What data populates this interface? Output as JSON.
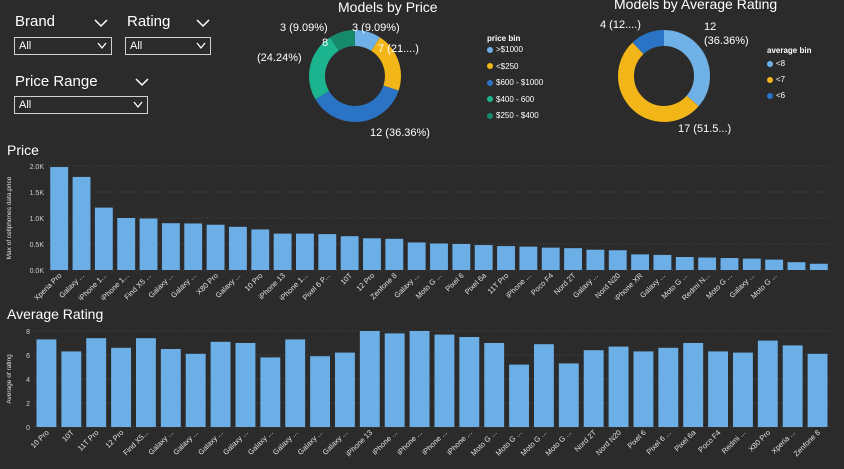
{
  "filters": {
    "brand": {
      "label": "Brand",
      "value": "All"
    },
    "rating": {
      "label": "Rating",
      "value": "All"
    },
    "price_range": {
      "label": "Price Range",
      "value": "All"
    }
  },
  "donut_price": {
    "title": "Models by Price",
    "legend_title": "price bin",
    "labels": {
      "a": "3 (9.09%)",
      "b": "7 (21....)",
      "c": "12 (36.36%)",
      "d": "8",
      "d2": "(24.24%)",
      "e": "3 (9.09%)"
    },
    "legend": [
      {
        "label": ">$1000",
        "color": "#6fb1e6"
      },
      {
        "label": "<$250",
        "color": "#f2b619"
      },
      {
        "label": "$600 - $1000",
        "color": "#2b73c4"
      },
      {
        "label": "$400 - 600",
        "color": "#1bb48e"
      },
      {
        "label": "$250 - $400",
        "color": "#178a6b"
      }
    ]
  },
  "donut_rating": {
    "title": "Models by Average Rating",
    "legend_title": "average bin",
    "labels": {
      "a": "4 (12....)",
      "b": "12",
      "b2": "(36.36%)",
      "c": "17 (51.5...)"
    },
    "legend": [
      {
        "label": "<8",
        "color": "#6fb1e6"
      },
      {
        "label": "<7",
        "color": "#f2b619"
      },
      {
        "label": "<6",
        "color": "#2b73c4"
      }
    ]
  },
  "chart_data": [
    {
      "type": "bar",
      "title": "Price",
      "ylabel": "Max of cellphones data.price",
      "ylim": [
        0,
        2000
      ],
      "yticks": [
        "0.0K",
        "0.5K",
        "1.0K",
        "1.5K",
        "2.0K"
      ],
      "categories": [
        "Xperia Pro",
        "Galaxy ...",
        "iPhone 1...",
        "iPhone 1...",
        "Find X5 ...",
        "Galaxy ...",
        "Galaxy ...",
        "X80 Pro",
        "Galaxy ...",
        "10 Pro",
        "iPhone 13",
        "iPhone 1...",
        "Pixel 6 P...",
        "10T",
        "12 Pro",
        "Zenfone 8",
        "Galaxy ...",
        "Moto G ...",
        "Pixel 6",
        "Pixel 6a",
        "11T Pro",
        "iPhone ...",
        "Poco F4",
        "Nord 2T",
        "Galaxy ...",
        "Nord N20",
        "iPhone XR",
        "Galaxy ...",
        "Moto G ...",
        "Redmi N...",
        "Moto G ...",
        "Galaxy ...",
        "Moto G ..."
      ],
      "values": [
        1980,
        1790,
        1200,
        1000,
        990,
        900,
        895,
        870,
        830,
        780,
        700,
        700,
        690,
        650,
        610,
        600,
        530,
        510,
        500,
        480,
        460,
        450,
        430,
        420,
        390,
        380,
        300,
        290,
        250,
        240,
        230,
        220,
        200,
        150,
        120
      ]
    },
    {
      "type": "bar",
      "title": "Average Rating",
      "ylabel": "Average of rating",
      "ylim": [
        0,
        8
      ],
      "yticks": [
        "0",
        "2",
        "4",
        "6",
        "8"
      ],
      "categories": [
        "10 Pro",
        "10T",
        "11T Pro",
        "12 Pro",
        "Find X5...",
        "Galaxy ...",
        "Galaxy ...",
        "Galaxy ...",
        "Galaxy ...",
        "Galaxy ...",
        "Galaxy ...",
        "Galaxy ...",
        "Galaxy ...",
        "iPhone 13",
        "iPhone ...",
        "iPhone ...",
        "iPhone ...",
        "iPhone ...",
        "Moto G ...",
        "Moto G ...",
        "Moto G ...",
        "Moto G ...",
        "Nord 2T",
        "Nord N20",
        "Pixel 6",
        "Pixel 6 ...",
        "Pixel 6a",
        "Poco F4",
        "Redmi ...",
        "X80 Pro",
        "Xperia ...",
        "Zenfone 8"
      ],
      "values": [
        7.3,
        6.3,
        7.4,
        6.6,
        7.4,
        6.5,
        6.1,
        7.1,
        7.0,
        5.8,
        7.3,
        5.9,
        6.2,
        8.0,
        7.8,
        8.0,
        7.7,
        7.5,
        7.0,
        5.2,
        6.9,
        5.3,
        6.4,
        6.7,
        6.3,
        6.6,
        7.0,
        6.3,
        6.2,
        7.2,
        6.8,
        6.1
      ]
    }
  ]
}
